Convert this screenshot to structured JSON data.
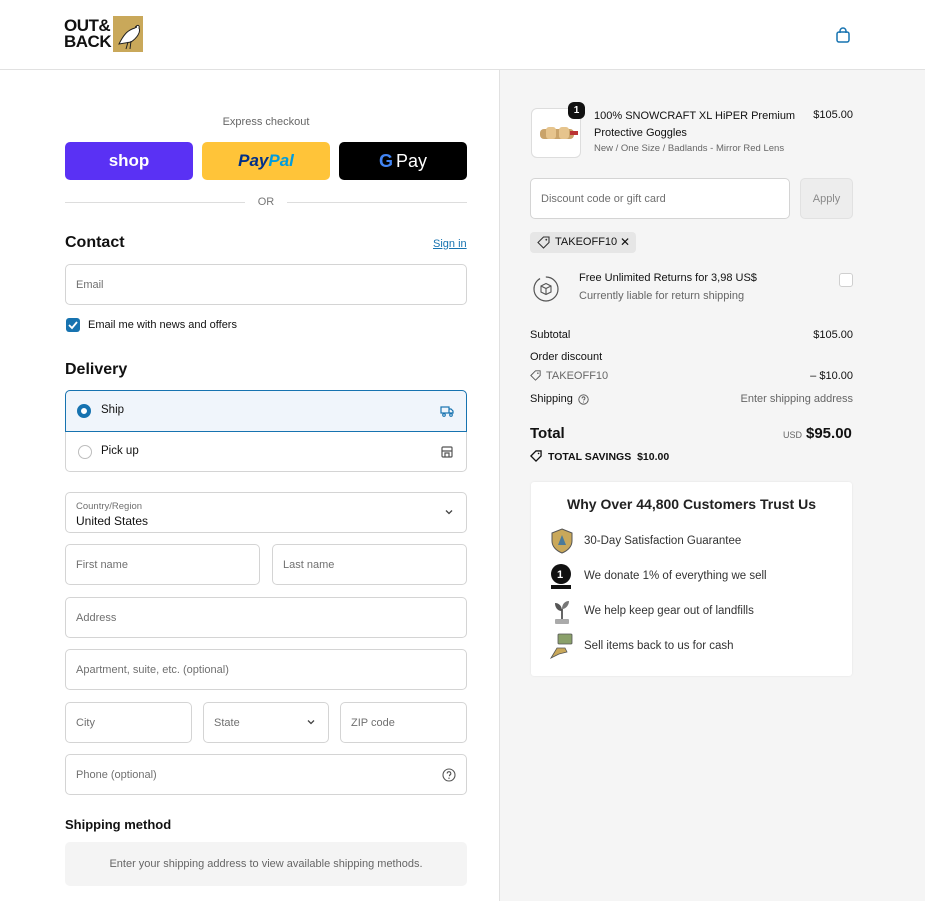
{
  "header": {
    "logo_line1": "OUT&",
    "logo_line2": "BACK"
  },
  "express": {
    "label": "Express checkout",
    "shop_label": "shop",
    "paypal_label_a": "Pay",
    "paypal_label_b": "Pal",
    "gpay_label": "Pay",
    "gpay_g": "G",
    "or": "OR"
  },
  "contact": {
    "title": "Contact",
    "signin": "Sign in",
    "email_placeholder": "Email",
    "newsletter_label": "Email me with news and offers",
    "newsletter_checked": true
  },
  "delivery": {
    "title": "Delivery",
    "options": [
      {
        "label": "Ship",
        "selected": true
      },
      {
        "label": "Pick up",
        "selected": false
      }
    ],
    "country_label": "Country/Region",
    "country_value": "United States",
    "first_name": "First name",
    "last_name": "Last name",
    "address": "Address",
    "apartment": "Apartment, suite, etc. (optional)",
    "city": "City",
    "state": "State",
    "zip": "ZIP code",
    "phone": "Phone (optional)"
  },
  "shipping_method": {
    "title": "Shipping method",
    "message": "Enter your shipping address to view available shipping methods."
  },
  "order": {
    "quantity": "1",
    "product_name": "100% SNOWCRAFT XL HiPER Premium Protective Goggles",
    "variant": "New / One Size / Badlands - Mirror Red Lens",
    "price": "$105.00",
    "discount_placeholder": "Discount code or gift card",
    "apply": "Apply",
    "applied_code": "TAKEOFF10",
    "returns_title": "Free Unlimited Returns for 3,98 US$",
    "returns_sub": "Currently liable for return shipping",
    "subtotal_label": "Subtotal",
    "subtotal_value": "$105.00",
    "order_discount_label": "Order discount",
    "discount_code": "TAKEOFF10",
    "discount_value": "– $10.00",
    "shipping_label": "Shipping",
    "shipping_value": "Enter shipping address",
    "total_label": "Total",
    "currency": "USD",
    "total_value": "$95.00",
    "savings_label": "TOTAL SAVINGS",
    "savings_value": "$10.00"
  },
  "trust": {
    "title": "Why Over 44,800 Customers Trust Us",
    "items": [
      {
        "text": "30-Day Satisfaction Guarantee",
        "icon": "shield-badge-icon"
      },
      {
        "text": "We donate 1% of everything we sell",
        "icon": "one-percent-planet-icon"
      },
      {
        "text": "We help keep gear out of landfills",
        "icon": "plant-icon"
      },
      {
        "text": "Sell items back to us for cash",
        "icon": "cash-hand-icon"
      }
    ]
  },
  "colors": {
    "accent": "#1773b0",
    "shop": "#5a31f4",
    "paypal": "#ffc439",
    "summary_bg": "#f5f5f5"
  }
}
